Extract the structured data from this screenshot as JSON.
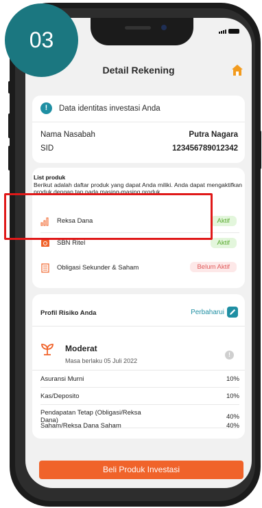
{
  "step_badge": "03",
  "header": {
    "title": "Detail Rekening"
  },
  "identity": {
    "heading": "Data identitas investasi Anda",
    "rows": [
      {
        "label": "Nama Nasabah",
        "value": "Putra Nagara"
      },
      {
        "label": "SID",
        "value": "123456789012342"
      }
    ]
  },
  "products": {
    "title": "List produk",
    "description": "Berikut adalah daftar produk yang dapat Anda miliki. Anda dapat mengaktifkan produk dengan tap pada masing-masing produk",
    "items": [
      {
        "label": "Reksa Dana",
        "status": "Aktif",
        "icon": "chart-icon"
      },
      {
        "label": "SBN Ritel",
        "status": "Aktif",
        "icon": "bond-icon"
      },
      {
        "label": "Obligasi Sekunder & Saham",
        "status": "Belum Aktif",
        "icon": "document-icon"
      }
    ]
  },
  "risk": {
    "title": "Profil Risiko Anda",
    "update_label": "Perbaharui",
    "profile": "Moderat",
    "validity": "Masa berlaku 05 Juli 2022",
    "allocations": [
      {
        "name": "Asuransi Murni",
        "value": "10%"
      },
      {
        "name": "Kas/Deposito",
        "value": "10%"
      },
      {
        "name": "Pendapatan Tetap (Obligasi/Reksa Dana)",
        "value": "40%"
      },
      {
        "name": "Saham/Reksa Dana Saham",
        "value": "40%"
      }
    ]
  },
  "cta": {
    "label": "Beli Produk Investasi"
  },
  "colors": {
    "accent": "#1f8fa3",
    "cta": "#f0632a",
    "highlight": "#e01919",
    "step": "#1b7780"
  }
}
